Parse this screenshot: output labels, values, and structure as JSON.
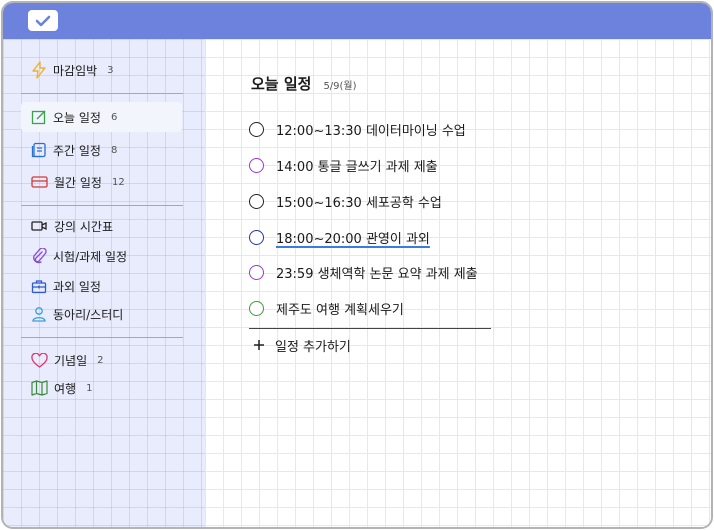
{
  "colors": {
    "titlebar": "#6c82dd",
    "sidebar": "#e8ecfc",
    "circle_black": "#222222",
    "circle_purple": "#9a36d6",
    "circle_navy": "#2633a8",
    "circle_green": "#3e9a3a",
    "underline": "#3f7ae0"
  },
  "sidebar": {
    "groups": [
      [
        {
          "icon": "lightning-icon",
          "label": "마감임박",
          "count": "3"
        }
      ],
      [
        {
          "icon": "edit-square-icon",
          "label": "오늘 일정",
          "count": "6",
          "active": true
        },
        {
          "icon": "document-icon",
          "label": "주간 일정",
          "count": "8"
        },
        {
          "icon": "card-icon",
          "label": "월간 일정",
          "count": "12"
        }
      ],
      [
        {
          "icon": "video-icon",
          "label": "강의 시간표",
          "count": ""
        },
        {
          "icon": "paperclip-icon",
          "label": "시험/과제 일정",
          "count": ""
        },
        {
          "icon": "briefcase-icon",
          "label": "과외 일정",
          "count": ""
        },
        {
          "icon": "person-icon",
          "label": "동아리/스터디",
          "count": ""
        }
      ],
      [
        {
          "icon": "heart-icon",
          "label": "기념일",
          "count": "2"
        },
        {
          "icon": "map-icon",
          "label": "여행",
          "count": "1"
        }
      ]
    ]
  },
  "main": {
    "title": "오늘 일정",
    "date": "5/9(월)",
    "tasks": [
      {
        "label": "12:00~13:30 데이터마이닝 수업",
        "circle": "black"
      },
      {
        "label": "14:00 통글 글쓰기 과제 제출",
        "circle": "purple"
      },
      {
        "label": "15:00~16:30 세포공학 수업",
        "circle": "black"
      },
      {
        "label": "18:00~20:00 관영이 과외",
        "circle": "navy"
      },
      {
        "label": "23:59 생체역학 논문 요약 과제 제출",
        "circle": "purple"
      },
      {
        "label": "제주도 여행 계획세우기",
        "circle": "green"
      }
    ],
    "add_label": "일정 추가하기",
    "add_icon": "plus-icon"
  }
}
